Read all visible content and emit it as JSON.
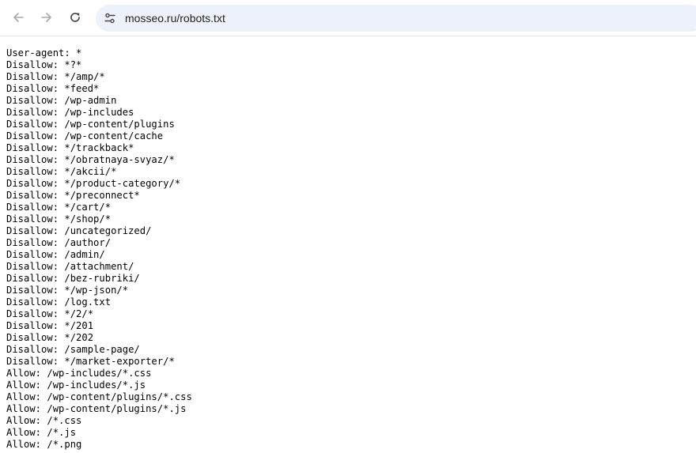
{
  "browser": {
    "url": "mosseo.ru/robots.txt",
    "icons": {
      "back": "arrow-left-icon",
      "forward": "arrow-right-icon",
      "reload": "reload-icon",
      "site_info": "tune-icon"
    }
  },
  "document": {
    "lines": [
      "User-agent: *",
      "Disallow: *?*",
      "Disallow: */amp/*",
      "Disallow: *feed*",
      "Disallow: /wp-admin",
      "Disallow: /wp-includes",
      "Disallow: /wp-content/plugins",
      "Disallow: /wp-content/cache",
      "Disallow: */trackback*",
      "Disallow: */obratnaya-svyaz/*",
      "Disallow: */akcii/*",
      "Disallow: */product-category/*",
      "Disallow: */preconnect*",
      "Disallow: */cart/*",
      "Disallow: */shop/*",
      "Disallow: /uncategorized/",
      "Disallow: /author/",
      "Disallow: /admin/",
      "Disallow: /attachment/",
      "Disallow: /bez-rubriki/",
      "Disallow: */wp-json/*",
      "Disallow: /log.txt",
      "Disallow: */2/*",
      "Disallow: */201",
      "Disallow: */202",
      "Disallow: /sample-page/",
      "Disallow: */market-exporter/*",
      "Allow: /wp-includes/*.css",
      "Allow: /wp-includes/*.js",
      "Allow: /wp-content/plugins/*.css",
      "Allow: /wp-content/plugins/*.js",
      "Allow: /*.css",
      "Allow: /*.js",
      "Allow: /*.png"
    ]
  }
}
